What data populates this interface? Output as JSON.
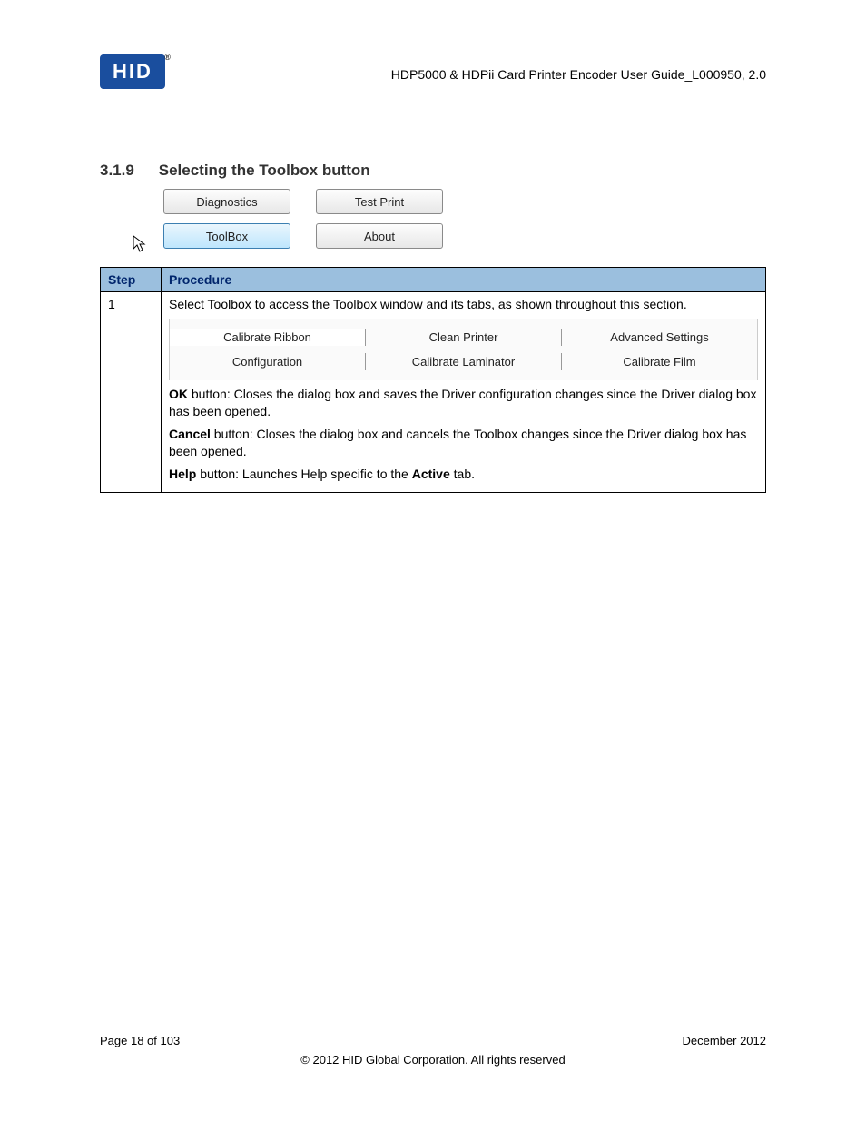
{
  "header": {
    "logo_text": "HID",
    "doc_title": "HDP5000 & HDPii Card Printer Encoder User Guide_L000950, 2.0"
  },
  "section": {
    "number": "3.1.9",
    "title": "Selecting the Toolbox button"
  },
  "buttons": {
    "diagnostics": "Diagnostics",
    "test_print": "Test Print",
    "toolbox": "ToolBox",
    "about": "About"
  },
  "table": {
    "header_step": "Step",
    "header_procedure": "Procedure",
    "step_num": "1",
    "intro": "Select Toolbox to access the Toolbox window and its tabs, as shown throughout this section.",
    "tabs": {
      "calibrate_ribbon": "Calibrate Ribbon",
      "clean_printer": "Clean Printer",
      "advanced_settings": "Advanced Settings",
      "configuration": "Configuration",
      "calibrate_laminator": "Calibrate Laminator",
      "calibrate_film": "Calibrate Film"
    },
    "desc": {
      "ok_bold": "OK",
      "ok_rest": " button:  Closes the dialog box and saves the Driver configuration changes since the Driver dialog box has been opened.",
      "cancel_bold": "Cancel",
      "cancel_rest": " button:  Closes the dialog box and cancels the Toolbox changes since the Driver dialog box has been opened.",
      "help_bold": "Help",
      "help_mid": " button:  Launches Help specific to the ",
      "active_bold": "Active",
      "help_end": " tab."
    }
  },
  "footer": {
    "page": "Page 18 of 103",
    "date": "December 2012",
    "copyright": "© 2012 HID Global Corporation. All rights reserved"
  }
}
